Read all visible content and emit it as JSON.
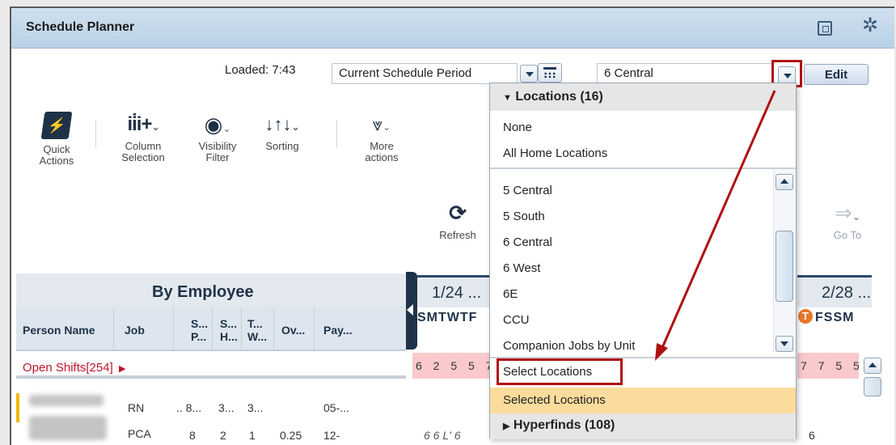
{
  "window": {
    "title": "Schedule Planner"
  },
  "controls": {
    "loaded_label": "Loaded: 7:43",
    "period_select": "Current Schedule Period",
    "location_select": "6 Central",
    "edit_label": "Edit"
  },
  "toolbar": {
    "quick_actions": "Quick\nActions",
    "column_selection": "Column\nSelection",
    "visibility_filter": "Visibility\nFilter",
    "sorting": "Sorting",
    "more_actions": "More\nactions",
    "refresh": "Refresh",
    "go_to": "Go To"
  },
  "dropdown": {
    "locations_header": "Locations (16)",
    "items_top": [
      "None",
      "All Home Locations"
    ],
    "list": [
      "5 Central",
      "5 South",
      "6 Central",
      "6 West",
      "6E",
      "CCU",
      "Companion Jobs by Unit"
    ],
    "select_locations": "Select Locations",
    "selected_locations": "Selected Locations",
    "hyperfinds_header": "Hyperfinds (108)"
  },
  "grid": {
    "title": "By Employee",
    "columns": {
      "person_name": "Person Name",
      "job": "Job",
      "sp": "S...\nP...",
      "sh": "S...\nH...",
      "tw": "T...\nW...",
      "ov": "Ov...",
      "pay": "Pay..."
    },
    "open_shifts": "Open Shifts[254]",
    "rows": [
      {
        "job": "RN",
        "c1": "8...",
        "c2": "3...",
        "c3": "3...",
        "ov": "",
        "pay": "05-..."
      },
      {
        "job": "PCA",
        "c1": "8",
        "c2": "2",
        "c3": "1",
        "ov": "0.25",
        "pay": "12-"
      }
    ],
    "period_1": "1/24 ...",
    "period_2": "2/28 ...",
    "days_1": "SMTWTF",
    "days_2": "FSSM",
    "today_letter": "T",
    "open_counts_1": "6 2 5 5 7 8",
    "open_counts_2": "7 7 5 5",
    "row_values_1": "6 6 L' 6",
    "row_values_2": "6"
  },
  "colors": {
    "title_bar": "#c3d7ea",
    "highlight_red": "#b01010",
    "selected_row": "#fbdc9c",
    "open_shift_red": "#c0152a",
    "pink_cells": "#f9c9cc"
  }
}
